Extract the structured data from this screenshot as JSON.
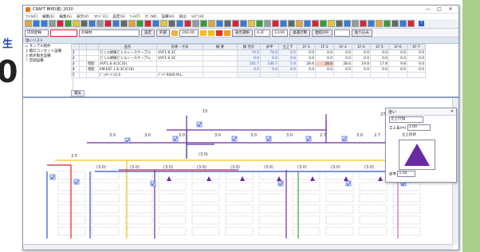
{
  "brand": {
    "side_char": "生",
    "side_big": "0"
  },
  "window": {
    "title": "CRAFT 幹材(建) 2020",
    "buttons": [
      "—",
      "□",
      "✕"
    ]
  },
  "menu": [
    "ﾌｧｲﾙ(F)",
    "編集(E)",
    "編集(S)",
    "表示(V)",
    "ｺﾏﾝﾄﾞ(C)",
    "設定(S)",
    "ﾂｰﾙ(T)",
    "ﾀﾌﾞ(W)",
    "設備(H)",
    "協(J)",
    "ﾍﾙﾌﾟ(H)"
  ],
  "toolbar": {
    "help": "?"
  },
  "propbar": {
    "layer": "内装配線",
    "field2": "外線材",
    "btn_setting": "設定",
    "btn_select": "外部",
    "zoom": "200.00",
    "btn_show": "表示選択",
    "layer_count": "4.2F",
    "scale": "1/100",
    "btn_collect": "桌選計算",
    "btn_snap": "連結OFF",
    "btn_paste": "貼り込み"
  },
  "table_panel": {
    "title": "拾いリスト",
    "tree": [
      "サンプル物件",
      "電灯コンセント設備",
      "給水衛生設備",
      "空調設備"
    ],
    "headers": [
      "",
      "",
      "",
      "品名",
      "形状・寸法",
      "摘 要",
      "総 合計",
      "水平",
      "立上下",
      "1F-1",
      "1F-2",
      "1F-3",
      "1F-4",
      "1F-5",
      "1F-6",
      "1F-7"
    ],
    "rows": [
      [
        "1",
        "",
        "",
        "ビニル絶縁ビニルシースケーブル",
        "VVF1.6-3C",
        "",
        "74.5",
        "74.0",
        "0.5",
        "0.0",
        "0.0",
        "0.0",
        "0.0",
        "0.0",
        "0.0",
        "0.0"
      ],
      [
        "2",
        "",
        "",
        "ビニル絶縁ビニルシースケーブル",
        "VVF1.6-3C",
        "",
        "0.0",
        "0.0",
        "0.0",
        "0.0",
        "0.0",
        "0.0",
        "0.0",
        "0.0",
        "0.0",
        "0.0"
      ],
      [
        "3",
        "",
        "埋配",
        "VVF1.6-3C(C16)",
        "",
        "",
        "141.7",
        "136.7",
        "5.0",
        "28.6",
        "28.6",
        "28.6",
        "19.8",
        "17.8",
        "9.8",
        "0.0"
      ],
      [
        "4",
        "",
        "埋配",
        "EM-EEF 1.6-3C(C16)",
        "",
        "",
        "0.0",
        "0.0",
        "0.0",
        "0.0",
        "0.0",
        "0.0",
        "0.0",
        "0.0",
        "0.0",
        "0.0"
      ],
      [
        "5",
        "",
        "",
        "ﾋﾞﾆﾙｹｰﾌﾞﾙ1.6",
        "ﾊﾟｲﾌﾟ6000 M.L.",
        "",
        "",
        "",
        "",
        "",
        "",
        "",
        "",
        "",
        "",
        ""
      ]
    ],
    "footer_tab": "電気"
  },
  "drawing": {
    "labels": [
      "15",
      "27",
      "3.0",
      "3.0",
      "3.0",
      "3.0",
      "3.0",
      "3.0",
      "2.7",
      "3.0",
      "2.7",
      "3.5",
      "(3.0)",
      "(3.0)",
      "(3.0)",
      "(3.0)",
      "(3.0)",
      "(3.0)",
      "(3.0)",
      "(3.0)",
      "(3.0)",
      "(3.0)",
      "(3.0)"
    ],
    "colors": {
      "red": "#d8262a",
      "blue": "#2f4fc9",
      "purple": "#6a2aa0",
      "yellow": "#f2c21a",
      "green": "#3aa83a",
      "pink": "#d768c0",
      "navy": "#1c2a80"
    }
  },
  "dialog": {
    "title": "拾い",
    "row1_label": "立上行加",
    "row2_label": "立上長(m)",
    "row2_value": "3.00",
    "row3_label": "立上形状",
    "row4_label": "係率",
    "row4_value": "1.00"
  }
}
